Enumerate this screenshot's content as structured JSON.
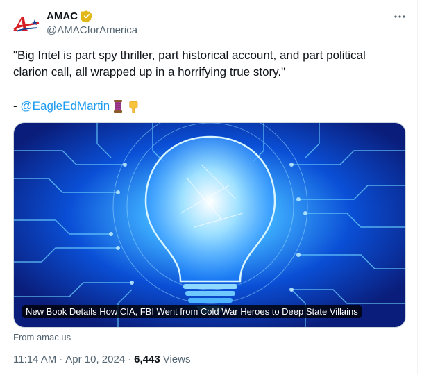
{
  "author": {
    "name": "AMAC",
    "handle": "@AMACforAmerica",
    "logo_letter": "A",
    "verified_badge_color": "#e2b719"
  },
  "tweet": {
    "lines": [
      "\"Big Intel is part spy thriller, part historical account, and part political",
      "clarion call, all wrapped up in a horrifying true story.\""
    ],
    "attribution_prefix": "- ",
    "mention": "@EagleEdMartin",
    "emoji_names": [
      "thread-spool-emoji",
      "pointing-down-emoji"
    ]
  },
  "card": {
    "caption": "New Book Details How CIA, FBI Went from Cold War Heroes to Deep State Villains",
    "source": "From amac.us"
  },
  "meta": {
    "time": "11:14 AM",
    "separator": "·",
    "date": "Apr 10, 2024",
    "views_count": "6,443",
    "views_label": "Views"
  },
  "colors": {
    "link": "#1d9bf0",
    "secondary_text": "#536471",
    "logo_red": "#d71f26"
  }
}
